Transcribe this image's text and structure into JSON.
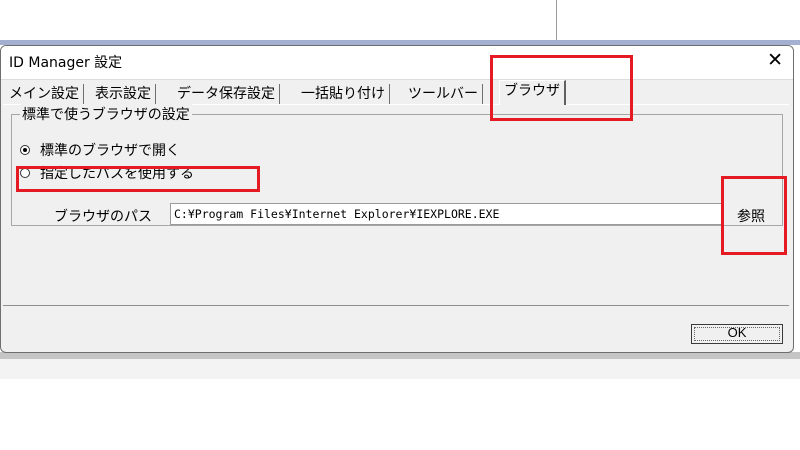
{
  "window": {
    "title": "ID Manager 設定",
    "close_glyph": "✕"
  },
  "tabs": [
    {
      "label": "メイン設定",
      "active": false
    },
    {
      "label": "表示設定",
      "active": false
    },
    {
      "label": "データ保存設定",
      "active": false
    },
    {
      "label": "一括貼り付け",
      "active": false
    },
    {
      "label": "ツールバー",
      "active": false
    },
    {
      "label": "ブラウザ",
      "active": true
    }
  ],
  "browser_settings": {
    "group_title": "標準で使うブラウザの設定",
    "option_default": "標準のブラウザで開く",
    "option_custom": "指定したパスを使用する",
    "selected_option": "default",
    "path_label": "ブラウザのパス",
    "path_value": "C:¥Program Files¥Internet Explorer¥IEXPLORE.EXE",
    "browse_label": "参照"
  },
  "footer": {
    "ok_label": "OK"
  },
  "colors": {
    "highlight": "#e51b24",
    "dialog_bg": "#f0f0f0"
  }
}
